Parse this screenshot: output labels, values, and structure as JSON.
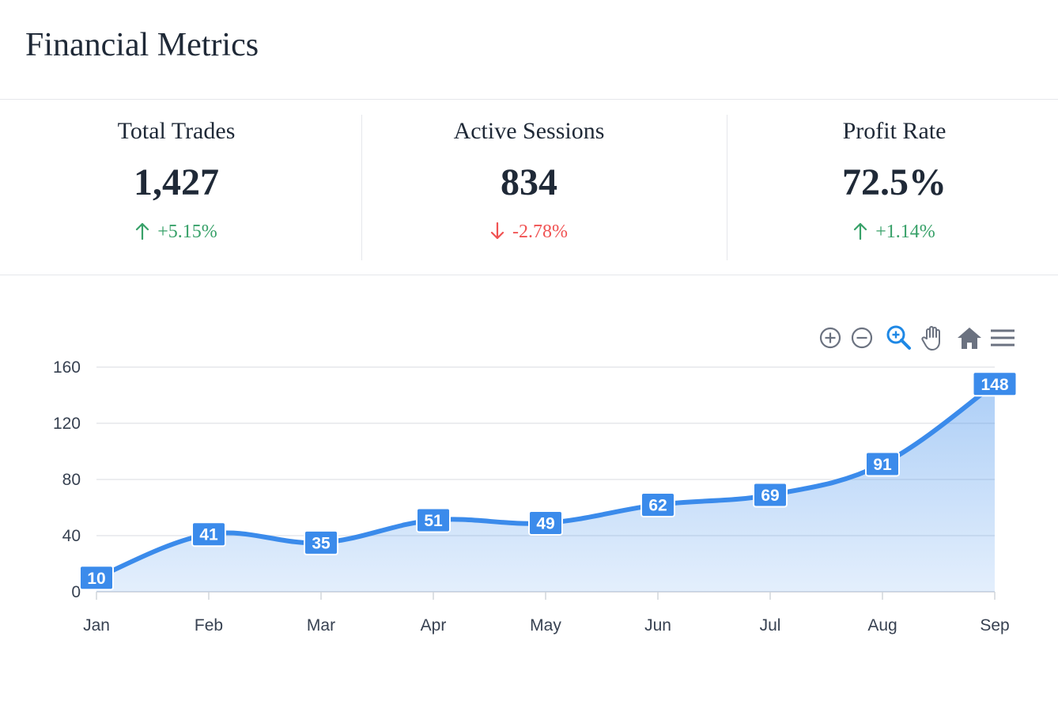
{
  "header": {
    "title": "Financial Metrics"
  },
  "metrics": [
    {
      "label": "Total Trades",
      "value": "1,427",
      "change": "+5.15%",
      "direction": "up"
    },
    {
      "label": "Active Sessions",
      "value": "834",
      "change": "-2.78%",
      "direction": "down"
    },
    {
      "label": "Profit Rate",
      "value": "72.5%",
      "change": "+1.14%",
      "direction": "up"
    }
  ],
  "colors": {
    "up": "#38a169",
    "down": "#f05252",
    "series": "#3b8beb",
    "axis_text": "#374151"
  },
  "toolbar": {
    "icons": [
      "zoom-in-icon",
      "zoom-out-icon",
      "selection-zoom-icon",
      "pan-hand-icon",
      "home-reset-icon",
      "menu-icon"
    ]
  },
  "chart_data": {
    "type": "area",
    "categories": [
      "Jan",
      "Feb",
      "Mar",
      "Apr",
      "May",
      "Jun",
      "Jul",
      "Aug",
      "Sep"
    ],
    "series": [
      {
        "values": [
          10,
          41,
          35,
          51,
          49,
          62,
          69,
          91,
          148
        ]
      }
    ],
    "ylim": [
      0,
      160
    ],
    "yticks": [
      0,
      40,
      80,
      120,
      160
    ],
    "data_labels": true,
    "grid": true,
    "title": "",
    "xlabel": "",
    "ylabel": ""
  }
}
